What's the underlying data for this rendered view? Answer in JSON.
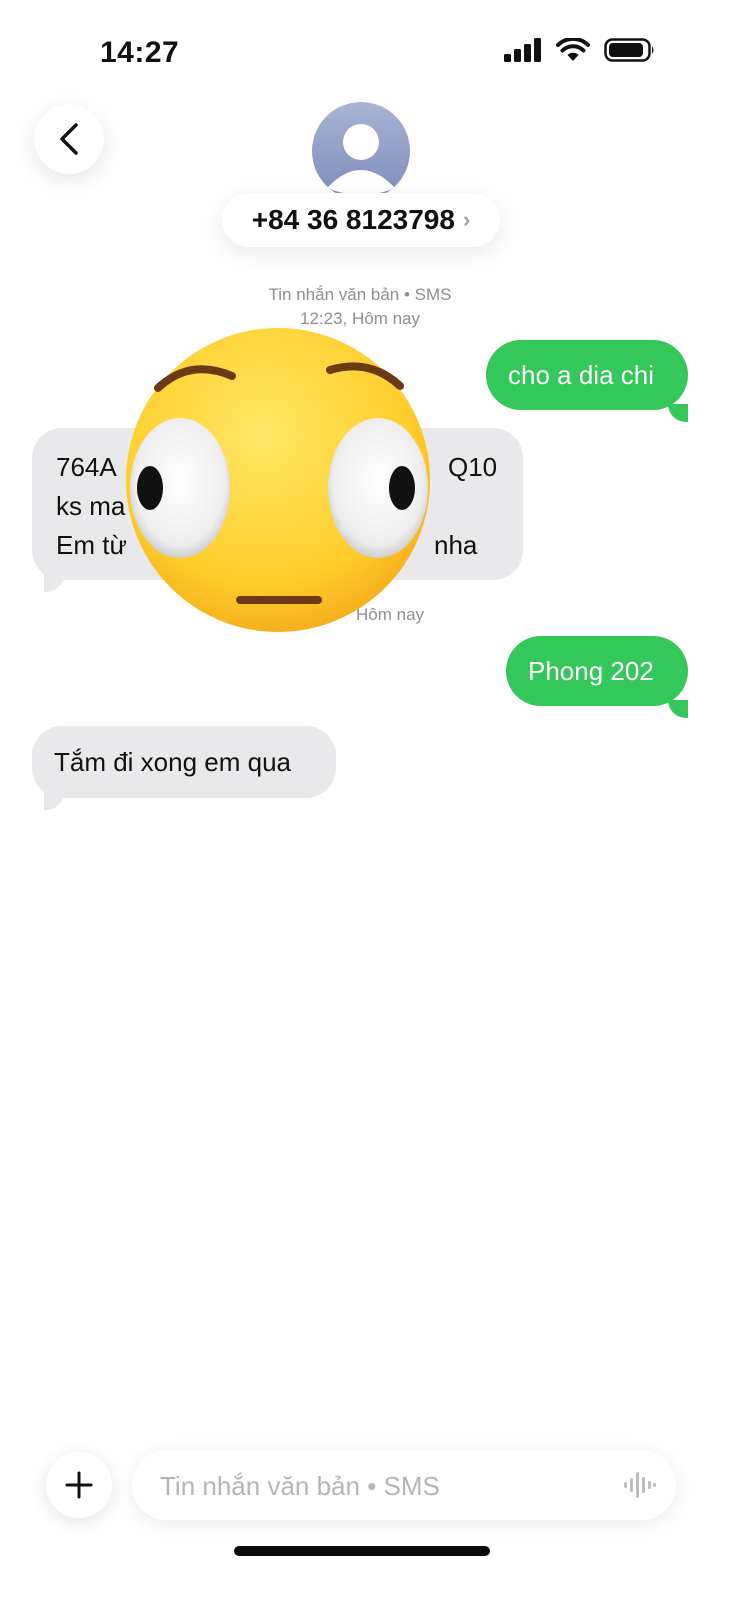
{
  "status": {
    "time": "14:27"
  },
  "header": {
    "contact": "+84 36 8123798",
    "chevron": "›",
    "back_icon": "chevron-left-icon"
  },
  "thread": {
    "meta_label": "Tin nhắn văn bản • SMS",
    "meta_time": "12:23, Hôm nay",
    "second_time": "Hôm nay",
    "messages": [
      {
        "direction": "outgoing",
        "text": "cho a dia chi"
      },
      {
        "direction": "incoming",
        "lines": [
          "764A",
          "Q10",
          "ks ma",
          "Em từ",
          "nha"
        ]
      },
      {
        "direction": "outgoing",
        "text": "Phong 202"
      },
      {
        "direction": "incoming",
        "text": "Tắm đi xong em qua"
      }
    ]
  },
  "sticker": {
    "name": "flushed-face-emoji"
  },
  "composer": {
    "placeholder": "Tin nhắn văn bản • SMS",
    "plus_icon": "plus-icon",
    "mic_icon": "waveform-icon"
  },
  "colors": {
    "outgoing_bubble": "#34c759",
    "incoming_bubble": "#e9e9eb",
    "timestamp": "#8e8e93"
  }
}
